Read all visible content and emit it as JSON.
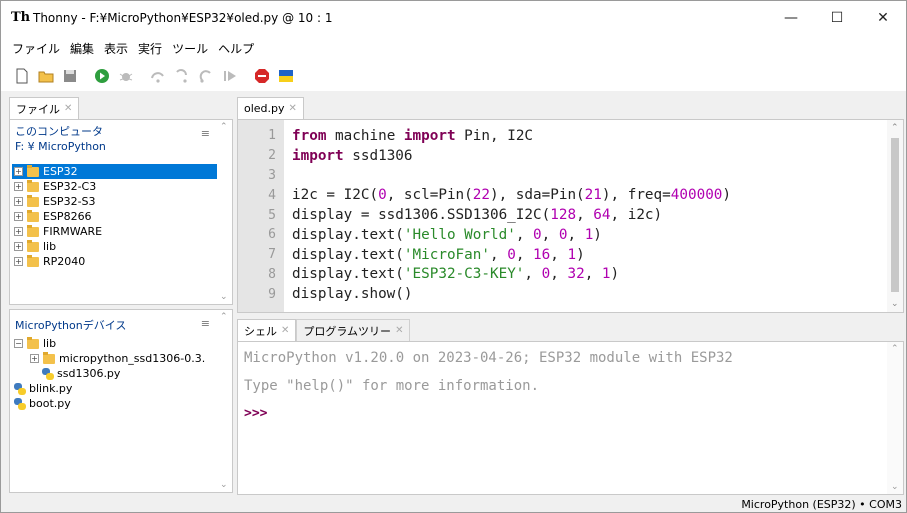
{
  "window": {
    "title": "Thonny  -  F:¥MicroPython¥ESP32¥oled.py  @  10 : 1",
    "app_icon_text": "Th"
  },
  "menu": [
    "ファイル",
    "編集",
    "表示",
    "実行",
    "ツール",
    "ヘルプ"
  ],
  "toolbar": {
    "icons": [
      "new-file-icon",
      "open-file-icon",
      "save-icon",
      "run-icon",
      "debug-icon",
      "step-over-icon",
      "step-into-icon",
      "step-out-icon",
      "resume-icon",
      "stop-icon",
      "ukraine-flag-icon"
    ]
  },
  "files_panel": {
    "tab": "ファイル",
    "computer": {
      "title": "このコンピュータ",
      "path": "F: ¥ MicroPython",
      "items": [
        {
          "label": "ESP32",
          "selected": true
        },
        {
          "label": "ESP32-C3",
          "selected": false
        },
        {
          "label": "ESP32-S3",
          "selected": false
        },
        {
          "label": "ESP8266",
          "selected": false
        },
        {
          "label": "FIRMWARE",
          "selected": false
        },
        {
          "label": "lib",
          "selected": false
        },
        {
          "label": "RP2040",
          "selected": false
        }
      ]
    },
    "device": {
      "title": "MicroPythonデバイス",
      "root": "lib",
      "lib_children": [
        "micropython_ssd1306-0.3.",
        "ssd1306.py"
      ],
      "files": [
        "blink.py",
        "boot.py"
      ]
    }
  },
  "editor": {
    "tab": "oled.py",
    "lines": [
      "1",
      "2",
      "3",
      "4",
      "5",
      "6",
      "7",
      "8",
      "9"
    ]
  },
  "shell": {
    "tabs": [
      "シェル",
      "プログラムツリー"
    ],
    "line1": "MicroPython v1.20.0 on 2023-04-26; ESP32 module with ESP32",
    "line2": "Type \"help()\" for more information.",
    "prompt": ">>>"
  },
  "status": {
    "interpreter": "MicroPython (ESP32)  •  COM3"
  },
  "colors": {
    "selection": "#0078d7",
    "keyword": "#7f0055",
    "number": "#b000b0",
    "string": "#2a8a2a"
  }
}
